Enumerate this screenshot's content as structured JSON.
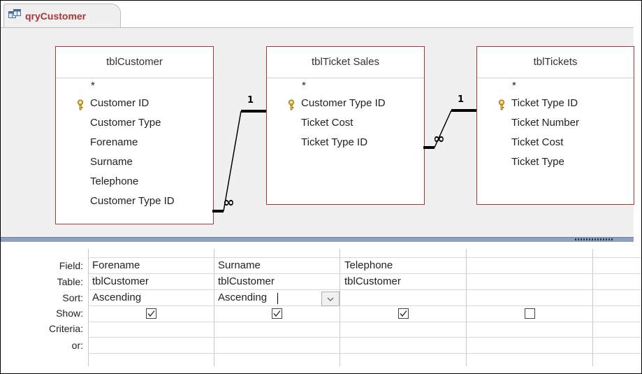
{
  "window": {
    "tab_label": "qryCustomer",
    "tab_icon": "query-design-icon"
  },
  "tables": [
    {
      "name": "tblCustomer",
      "star": "*",
      "fields": [
        {
          "label": "Customer ID",
          "key": true
        },
        {
          "label": "Customer Type",
          "key": false
        },
        {
          "label": "Forename",
          "key": false
        },
        {
          "label": "Surname",
          "key": false
        },
        {
          "label": "Telephone",
          "key": false
        },
        {
          "label": "Customer Type ID",
          "key": false
        }
      ]
    },
    {
      "name": "tblTicket Sales",
      "star": "*",
      "fields": [
        {
          "label": "Customer Type ID",
          "key": true
        },
        {
          "label": "Ticket Cost",
          "key": false
        },
        {
          "label": "Ticket Type ID",
          "key": false
        }
      ]
    },
    {
      "name": "tblTickets",
      "star": "*",
      "fields": [
        {
          "label": "Ticket Type ID",
          "key": true
        },
        {
          "label": "Ticket Number",
          "key": false
        },
        {
          "label": "Ticket Cost",
          "key": false
        },
        {
          "label": "Ticket Type",
          "key": false
        }
      ]
    }
  ],
  "relationships": [
    {
      "one_label": "1",
      "many_label": "∞"
    },
    {
      "one_label": "1",
      "many_label": "∞"
    }
  ],
  "grid": {
    "row_labels": {
      "field": "Field:",
      "table": "Table:",
      "sort": "Sort:",
      "show": "Show:",
      "criteria": "Criteria:",
      "or": "or:"
    },
    "columns": [
      {
        "field": "Forename",
        "table": "tblCustomer",
        "sort": "Ascending",
        "show": true
      },
      {
        "field": "Surname",
        "table": "tblCustomer",
        "sort": "Ascending",
        "show": true
      },
      {
        "field": "Telephone",
        "table": "tblCustomer",
        "sort": "",
        "show": true
      },
      {
        "field": "",
        "table": "",
        "sort": "",
        "show": false
      }
    ]
  },
  "colors": {
    "table_border": "#a4373a",
    "tab_text": "#a4373a",
    "pane_background": "#f0f0f0",
    "splitter": "#8ea1bf"
  }
}
